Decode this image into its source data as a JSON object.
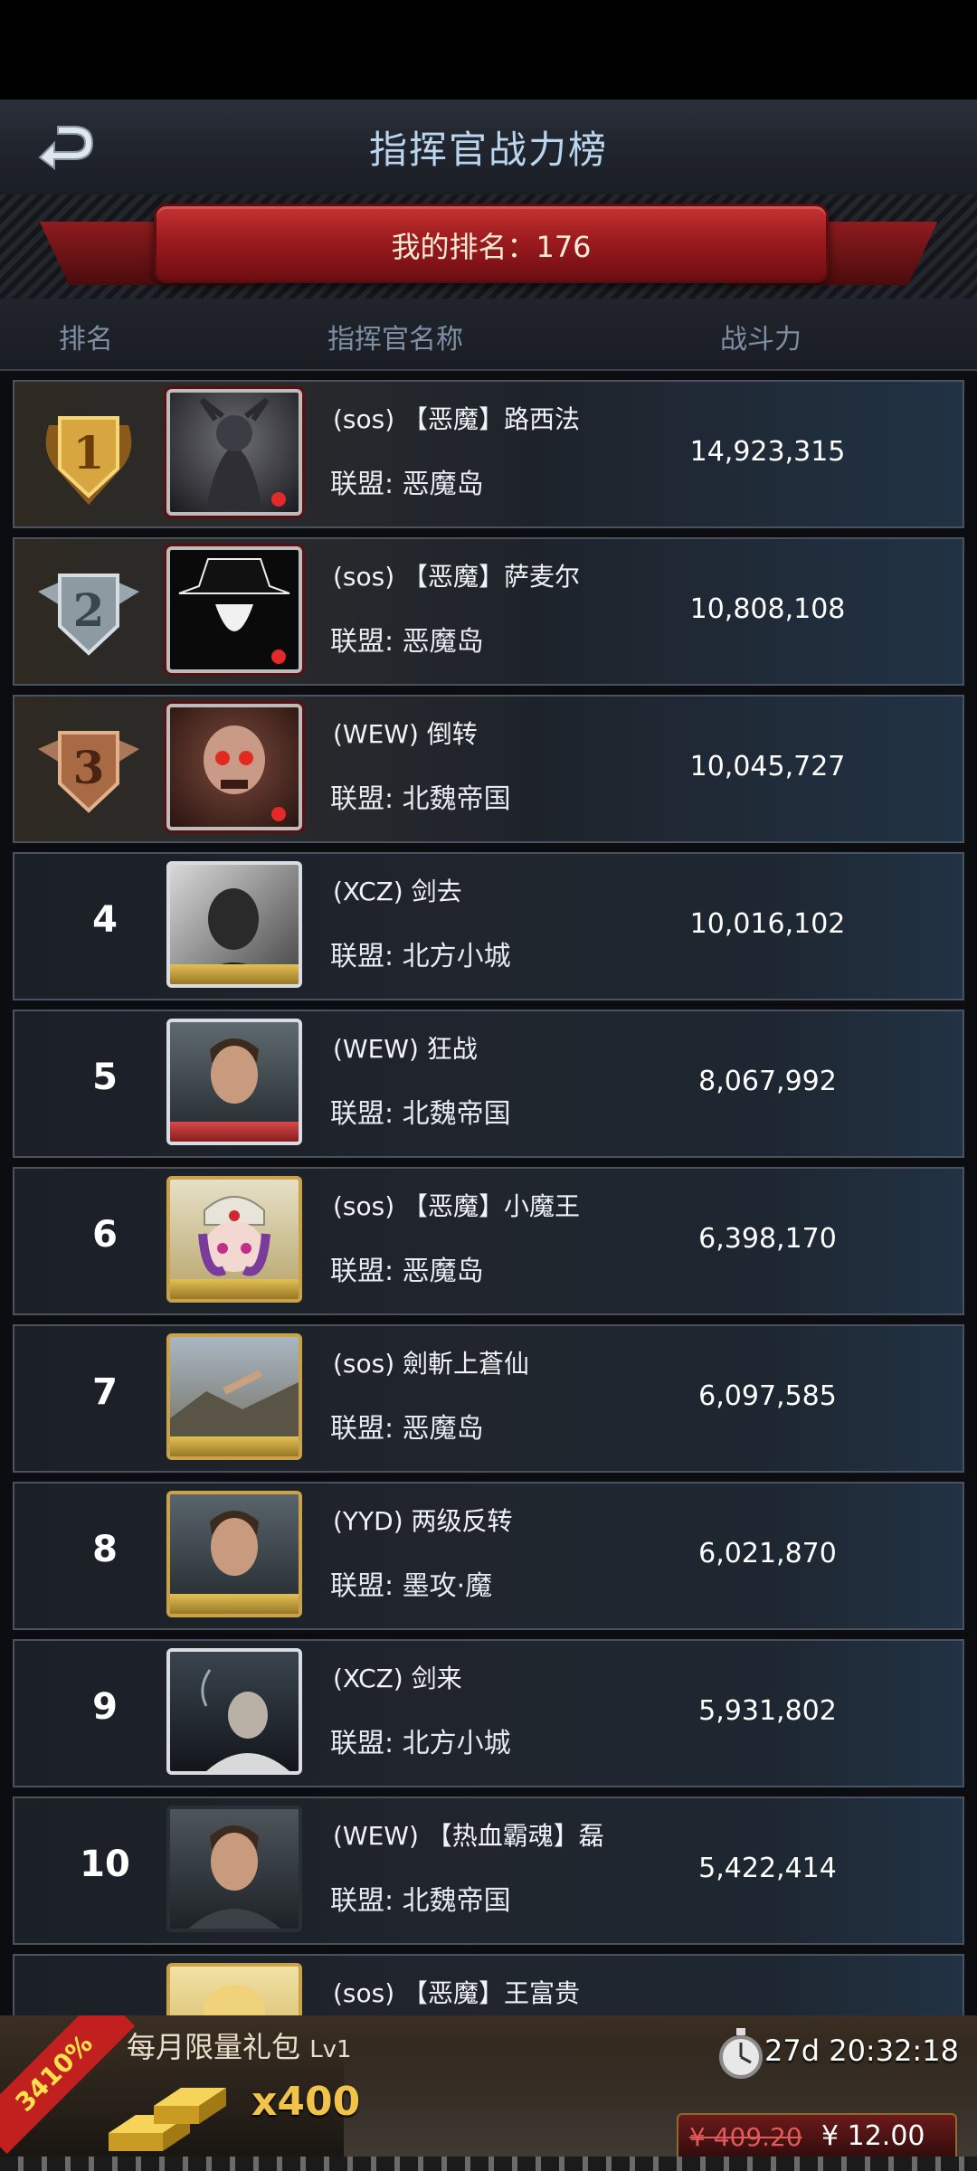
{
  "header": {
    "title": "指挥官战力榜",
    "back_icon": "back-arrow-icon"
  },
  "my_rank": {
    "text": "我的排名：176"
  },
  "columns": {
    "rank": "排名",
    "name": "指挥官名称",
    "power": "战斗力"
  },
  "rows": [
    {
      "rank": "1",
      "medal": "gold",
      "name": "(sos) 【恶魔】路西法",
      "alliance": "联盟: 恶魔岛",
      "power": "14,923,315"
    },
    {
      "rank": "2",
      "medal": "silver",
      "name": "(sos) 【恶魔】萨麦尔",
      "alliance": "联盟: 恶魔岛",
      "power": "10,808,108"
    },
    {
      "rank": "3",
      "medal": "bronze",
      "name": "(WEW) 倒转",
      "alliance": "联盟: 北魏帝国",
      "power": "10,045,727"
    },
    {
      "rank": "4",
      "name": "(XCZ) 剑去",
      "alliance": "联盟: 北方小城",
      "power": "10,016,102"
    },
    {
      "rank": "5",
      "name": "(WEW) 狂战",
      "alliance": "联盟: 北魏帝国",
      "power": "8,067,992"
    },
    {
      "rank": "6",
      "name": "(sos) 【恶魔】小魔王",
      "alliance": "联盟: 恶魔岛",
      "power": "6,398,170"
    },
    {
      "rank": "7",
      "name": "(sos) 劍斬上蒼仙",
      "alliance": "联盟: 恶魔岛",
      "power": "6,097,585"
    },
    {
      "rank": "8",
      "name": "(YYD) 两级反转",
      "alliance": "联盟: 墨攻·魔",
      "power": "6,021,870"
    },
    {
      "rank": "9",
      "name": "(XCZ) 剑来",
      "alliance": "联盟: 北方小城",
      "power": "5,931,802"
    },
    {
      "rank": "10",
      "name": "(WEW) 【热血霸魂】磊",
      "alliance": "联盟: 北魏帝国",
      "power": "5,422,414"
    },
    {
      "rank": "",
      "name": "(sos) 【恶魔】王富贵",
      "alliance": "",
      "power": ""
    }
  ],
  "promo": {
    "discount": "3410%",
    "title": "每月限量礼包",
    "level": "Lv1",
    "quantity": "x400",
    "timer": "27d 20:32:18",
    "old_price": "¥ 409.20",
    "new_price": "¥ 12.00"
  },
  "colors": {
    "banner_red": "#9d1b1e",
    "title_blue": "#b9d6ee",
    "gold": "#f1c34a"
  }
}
